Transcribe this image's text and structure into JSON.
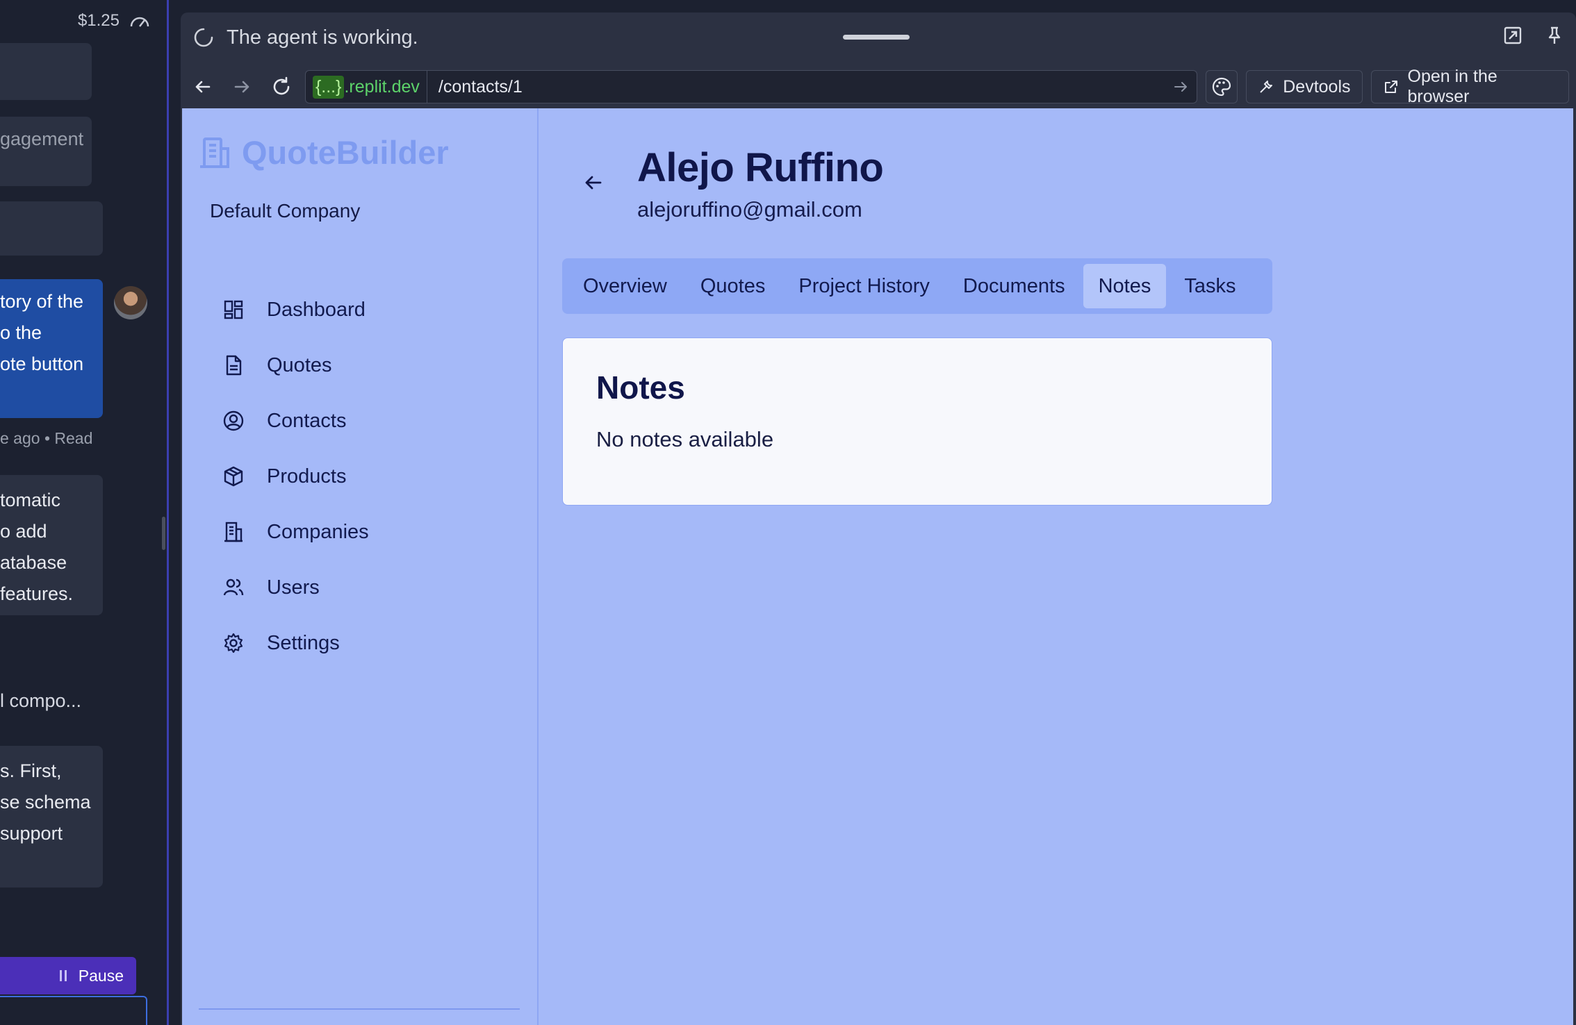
{
  "chat": {
    "cost": "$1.25",
    "bubble1": "",
    "bubble2": "gagement",
    "user_msg": [
      "tory of the",
      "o the",
      "ote button"
    ],
    "meta": "e ago • Read",
    "msg3": [
      "tomatic",
      "o add",
      "atabase",
      " features."
    ],
    "line": "l compo...",
    "msg4": [
      "s. First,",
      "se schema",
      " support"
    ],
    "pause_label": "Pause"
  },
  "preview": {
    "status": "The agent is working.",
    "url": {
      "domain_pill": "{...}",
      "domain_rest": ".replit.dev",
      "path": "/contacts/1"
    },
    "devtools_label": "Devtools",
    "open_browser_label": "Open in the browser"
  },
  "app": {
    "brand": "QuoteBuilder",
    "company": "Default Company",
    "nav": [
      {
        "label": "Dashboard",
        "icon": "dashboard-icon"
      },
      {
        "label": "Quotes",
        "icon": "document-icon"
      },
      {
        "label": "Contacts",
        "icon": "user-circle-icon"
      },
      {
        "label": "Products",
        "icon": "cube-icon"
      },
      {
        "label": "Companies",
        "icon": "building-icon"
      },
      {
        "label": "Users",
        "icon": "users-icon"
      },
      {
        "label": "Settings",
        "icon": "gear-icon"
      }
    ],
    "contact": {
      "name": "Alejo Ruffino",
      "email": "alejoruffino@gmail.com"
    },
    "tabs": [
      "Overview",
      "Quotes",
      "Project History",
      "Documents",
      "Notes",
      "Tasks"
    ],
    "active_tab": "Notes",
    "card": {
      "title": "Notes",
      "empty": "No notes available"
    },
    "colors": {
      "background": "#a5b9f8",
      "text": "#10164a",
      "brand": "#7e9bf0",
      "card": "#f7f8fc"
    }
  }
}
